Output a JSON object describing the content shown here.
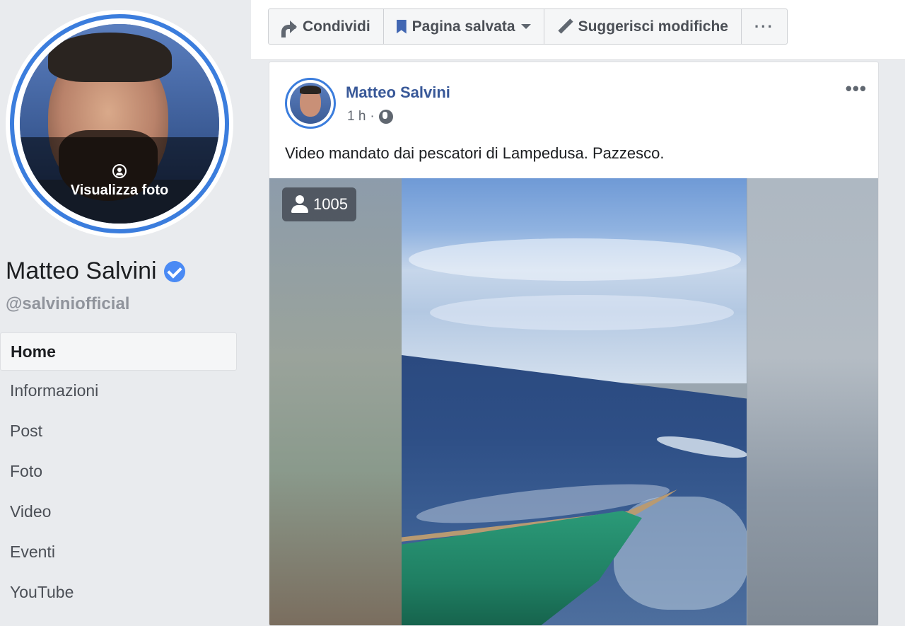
{
  "profile": {
    "view_photo_label": "Visualizza foto",
    "name": "Matteo Salvini",
    "handle": "@salviniofficial"
  },
  "nav": {
    "items": [
      {
        "label": "Home",
        "active": true
      },
      {
        "label": "Informazioni"
      },
      {
        "label": "Post"
      },
      {
        "label": "Foto"
      },
      {
        "label": "Video"
      },
      {
        "label": "Eventi"
      },
      {
        "label": "YouTube"
      }
    ]
  },
  "toolbar": {
    "share_label": "Condividi",
    "saved_label": "Pagina salvata",
    "suggest_label": "Suggerisci modifiche",
    "more_label": "···"
  },
  "post": {
    "author": "Matteo Salvini",
    "time": "1 h",
    "separator": "·",
    "more_label": "•••",
    "text": "Video mandato dai pescatori di Lampedusa. Pazzesco.",
    "viewers": "1005"
  },
  "colors": {
    "accent": "#3b7ddd",
    "link": "#385898",
    "verified": "#4a8af4",
    "background": "#e9ebee"
  },
  "icons": [
    "share-icon",
    "bookmark-icon",
    "chevron-down-icon",
    "pencil-icon",
    "more-icon",
    "globe-icon",
    "person-icon",
    "verified-icon",
    "user-circle-icon"
  ]
}
